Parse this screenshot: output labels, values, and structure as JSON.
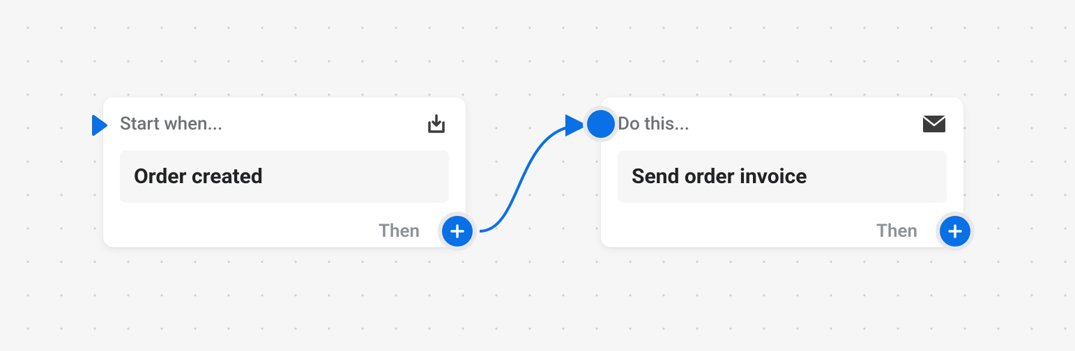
{
  "trigger": {
    "header": "Start when...",
    "body": "Order created",
    "footer": "Then",
    "icon": "download-icon"
  },
  "action": {
    "header": "Do this...",
    "body": "Send order invoice",
    "footer": "Then",
    "icon": "mail-icon"
  },
  "colors": {
    "accent": "#0970e6",
    "muted": "#6d7175",
    "dark": "#3c3c3c"
  }
}
